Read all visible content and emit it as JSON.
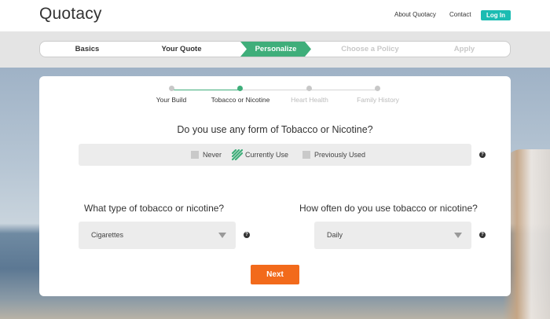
{
  "header": {
    "logo": "Quotacy",
    "about_label": "About Quotacy",
    "contact_label": "Contact",
    "login_label": "Log In"
  },
  "progress": {
    "steps": [
      {
        "label": "Basics",
        "state": "done"
      },
      {
        "label": "Your Quote",
        "state": "done"
      },
      {
        "label": "Personalize",
        "state": "active"
      },
      {
        "label": "Choose a Policy",
        "state": "todo"
      },
      {
        "label": "Apply",
        "state": "todo"
      }
    ]
  },
  "timeline": {
    "items": [
      {
        "label": "Your Build",
        "state": "done"
      },
      {
        "label": "Tobacco or Nicotine",
        "state": "active"
      },
      {
        "label": "Heart Health",
        "state": "todo"
      },
      {
        "label": "Family History",
        "state": "todo"
      }
    ]
  },
  "question": "Do you use any form of Tobacco or Nicotine?",
  "options": [
    {
      "label": "Never",
      "checked": false
    },
    {
      "label": "Currently Use",
      "checked": true
    },
    {
      "label": "Previously Used",
      "checked": false
    }
  ],
  "help_symbol": "?",
  "type_question": "What type of tobacco or nicotine?",
  "type_value": "Cigarettes",
  "frequency_question": "How often do you use tobacco or nicotine?",
  "frequency_value": "Daily",
  "next_label": "Next",
  "colors": {
    "accent_green": "#3fae7a",
    "teal": "#1bbcb2",
    "orange": "#f26a1b"
  }
}
